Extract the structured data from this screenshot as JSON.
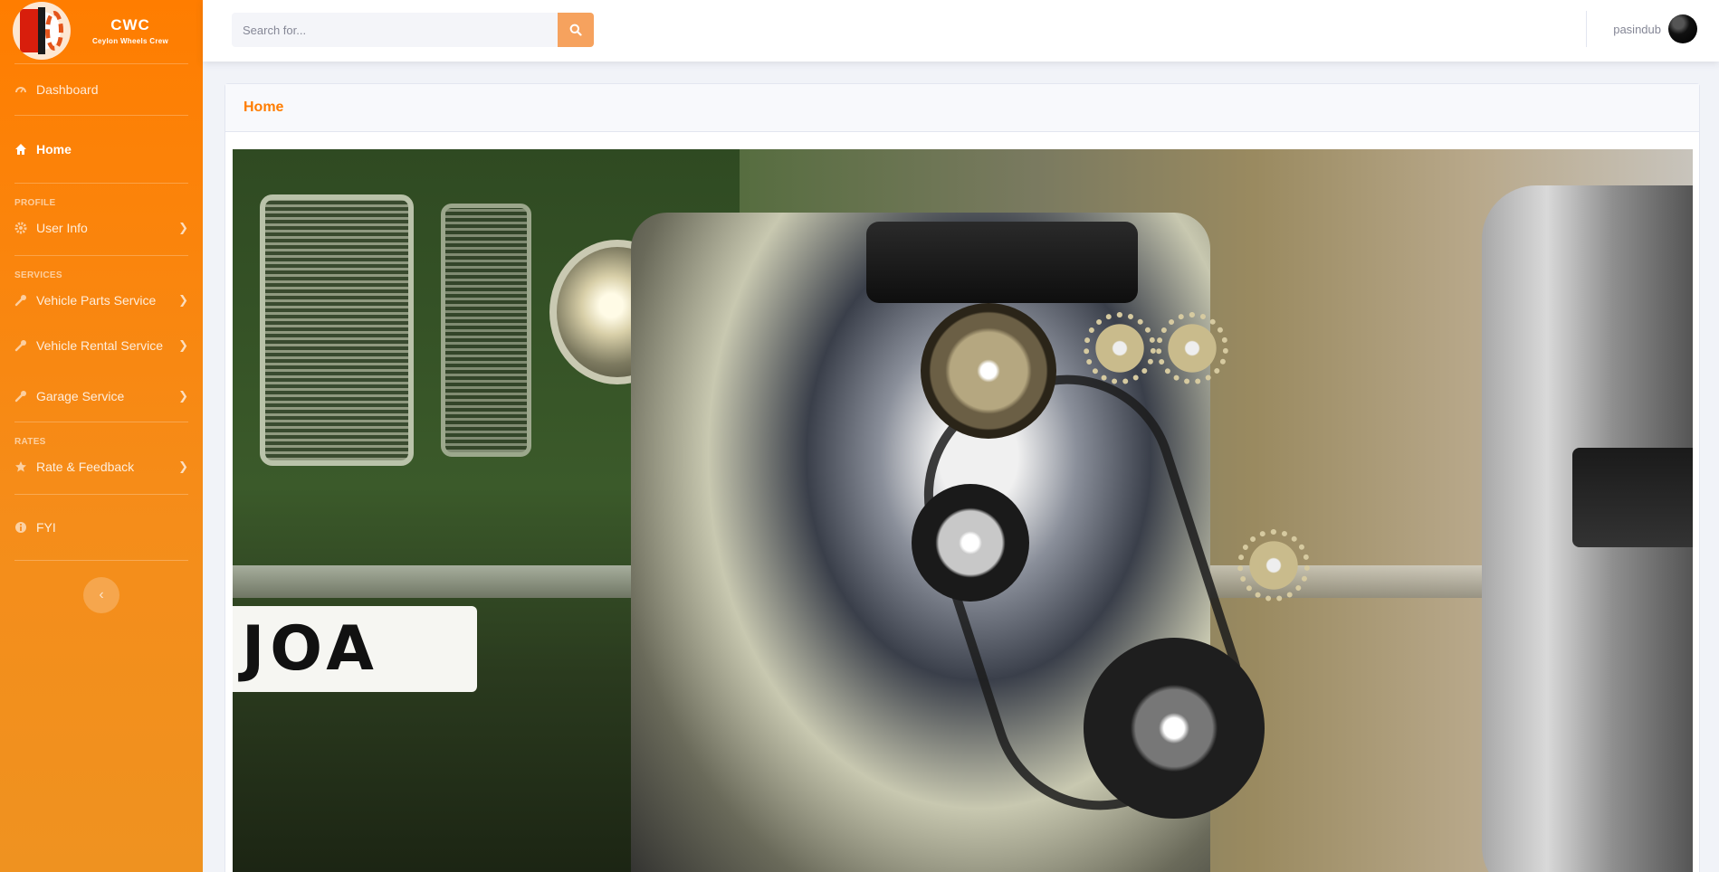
{
  "brand": {
    "name": "CWC",
    "subtitle": "Ceylon Wheels Crew"
  },
  "sidebar": {
    "dashboard": {
      "label": "Dashboard",
      "icon": "tachometer-icon"
    },
    "home": {
      "label": "Home",
      "icon": "home-icon",
      "active": true
    },
    "profile_heading": "PROFILE",
    "user_info": {
      "label": "User Info",
      "icon": "gear-icon"
    },
    "services_heading": "SERVICES",
    "services": [
      {
        "label": "Vehicle Parts Service",
        "icon": "wrench-icon"
      },
      {
        "label": "Vehicle Rental Service",
        "icon": "wrench-icon"
      },
      {
        "label": "Garage Service",
        "icon": "wrench-icon"
      }
    ],
    "rates_heading": "RATES",
    "rate_feedback": {
      "label": "Rate & Feedback",
      "icon": "star-icon"
    },
    "fyi": {
      "label": "FYI",
      "icon": "info-icon"
    },
    "toggle_glyph": "‹"
  },
  "topbar": {
    "search_placeholder": "Search for...",
    "username": "pasindub"
  },
  "card": {
    "title": "Home",
    "image": {
      "plate_text": "JOA"
    }
  },
  "colors": {
    "accent": "#ff7d00",
    "search_button": "#f6a25e"
  }
}
